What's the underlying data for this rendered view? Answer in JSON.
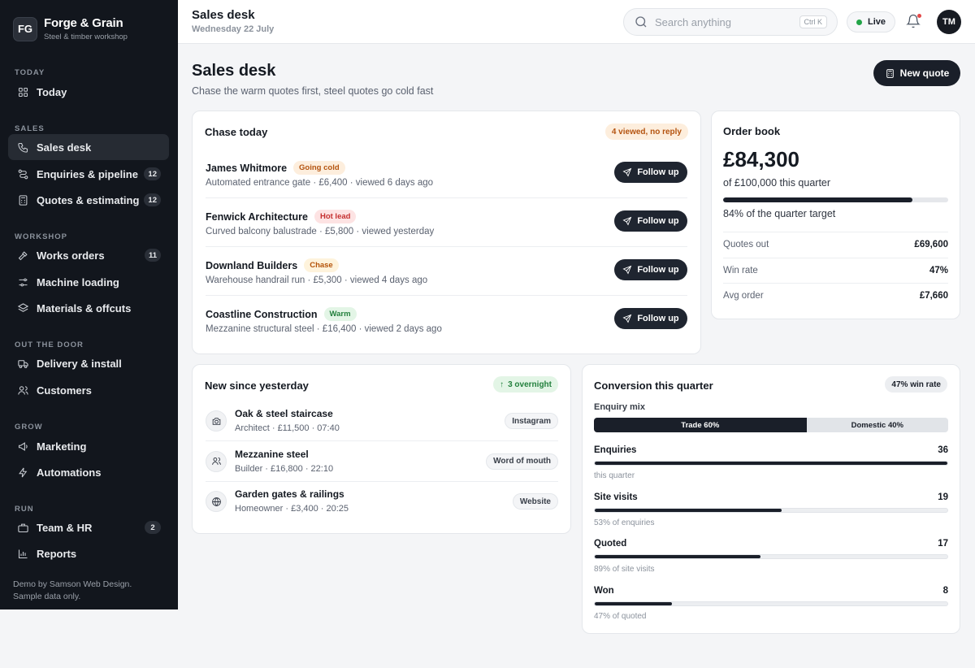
{
  "brand": {
    "initials": "FG",
    "name": "Forge & Grain",
    "subtitle": "Steel & timber workshop"
  },
  "sidebar": {
    "sections": [
      {
        "label": "TODAY",
        "items": [
          {
            "label": "Today",
            "icon": "grid-icon"
          }
        ]
      },
      {
        "label": "SALES",
        "items": [
          {
            "label": "Sales desk",
            "icon": "phone-icon",
            "active": true
          },
          {
            "label": "Enquiries & pipeline",
            "icon": "pipeline-icon",
            "count": "12"
          },
          {
            "label": "Quotes & estimating",
            "icon": "calculator-icon",
            "count": "12"
          }
        ]
      },
      {
        "label": "WORKSHOP",
        "items": [
          {
            "label": "Works orders",
            "icon": "hammer-icon",
            "count": "11"
          },
          {
            "label": "Machine loading",
            "icon": "sliders-icon"
          },
          {
            "label": "Materials & offcuts",
            "icon": "layers-icon"
          }
        ]
      },
      {
        "label": "OUT THE DOOR",
        "items": [
          {
            "label": "Delivery & install",
            "icon": "truck-icon"
          },
          {
            "label": "Customers",
            "icon": "users-icon"
          }
        ]
      },
      {
        "label": "GROW",
        "items": [
          {
            "label": "Marketing",
            "icon": "megaphone-icon"
          },
          {
            "label": "Automations",
            "icon": "bolt-icon"
          }
        ]
      },
      {
        "label": "RUN",
        "items": [
          {
            "label": "Team & HR",
            "icon": "briefcase-icon",
            "count": "2"
          },
          {
            "label": "Reports",
            "icon": "chart-icon"
          }
        ]
      }
    ],
    "footer_line1": "Demo by Samson Web Design.",
    "footer_line2": "Sample data only."
  },
  "header": {
    "title": "Sales desk",
    "date": "Wednesday 22 July",
    "search_placeholder": "Search anything",
    "search_shortcut": "Ctrl K",
    "live_label": "Live",
    "avatar": "TM"
  },
  "page": {
    "title": "Sales desk",
    "subtitle": "Chase the warm quotes first, steel quotes go cold fast",
    "new_quote_label": "New quote"
  },
  "chase": {
    "title": "Chase today",
    "badge": "4 viewed, no reply",
    "button_label": "Follow up",
    "rows": [
      {
        "name": "James Whitmore",
        "tag": "Going cold",
        "tag_style": "cold",
        "detail": "Automated entrance gate · £6,400 · viewed 6 days ago"
      },
      {
        "name": "Fenwick Architecture",
        "tag": "Hot lead",
        "tag_style": "hot",
        "detail": "Curved balcony balustrade · £5,800 · viewed yesterday"
      },
      {
        "name": "Downland Builders",
        "tag": "Chase",
        "tag_style": "chase",
        "detail": "Warehouse handrail run · £5,300 · viewed 4 days ago"
      },
      {
        "name": "Coastline Construction",
        "tag": "Warm",
        "tag_style": "warm",
        "detail": "Mezzanine structural steel · £16,400 · viewed 2 days ago"
      }
    ]
  },
  "order_book": {
    "title": "Order book",
    "amount": "£84,300",
    "of_target": "of £100,000 this quarter",
    "progress": 0.84,
    "progress_label": "84% of the quarter target",
    "rows": [
      {
        "label": "Quotes out",
        "value": "£69,600"
      },
      {
        "label": "Win rate",
        "value": "47%"
      },
      {
        "label": "Avg order",
        "value": "£7,660"
      }
    ]
  },
  "new_since": {
    "title": "New since yesterday",
    "badge": "3 overnight",
    "rows": [
      {
        "name": "Oak & steel staircase",
        "detail": "Architect · £11,500 · 07:40",
        "source": "Instagram",
        "icon": "camera-icon"
      },
      {
        "name": "Mezzanine steel",
        "detail": "Builder · £16,800 · 22:10",
        "source": "Word of mouth",
        "icon": "people-icon"
      },
      {
        "name": "Garden gates & railings",
        "detail": "Homeowner · £3,400 · 20:25",
        "source": "Website",
        "icon": "globe-icon"
      }
    ]
  },
  "conversion": {
    "title": "Conversion this quarter",
    "badge": "47% win rate",
    "mix_label": "Enquiry mix",
    "mix": [
      {
        "label": "Trade 60%",
        "share": 0.6
      },
      {
        "label": "Domestic 40%",
        "share": 0.4
      }
    ],
    "metrics": [
      {
        "label": "Enquiries",
        "value": "36",
        "fill": 1.0,
        "sub": "this quarter"
      },
      {
        "label": "Site visits",
        "value": "19",
        "fill": 0.53,
        "sub": "53% of enquiries"
      },
      {
        "label": "Quoted",
        "value": "17",
        "fill": 0.47,
        "sub": "89% of site visits"
      },
      {
        "label": "Won",
        "value": "8",
        "fill": 0.22,
        "sub": "47% of quoted"
      }
    ]
  },
  "colors": {
    "sidebar_bg": "#12161d",
    "accent_dark": "#1a1f29",
    "live_green": "#22a447",
    "tag_cold_bg": "#fdeedd",
    "tag_cold_fg": "#b4530f",
    "tag_hot_bg": "#fde3e3",
    "tag_hot_fg": "#c53030",
    "tag_chase_bg": "#fef3dc",
    "tag_chase_fg": "#b45309",
    "tag_warm_bg": "#e3f5e6",
    "tag_warm_fg": "#23803d"
  }
}
